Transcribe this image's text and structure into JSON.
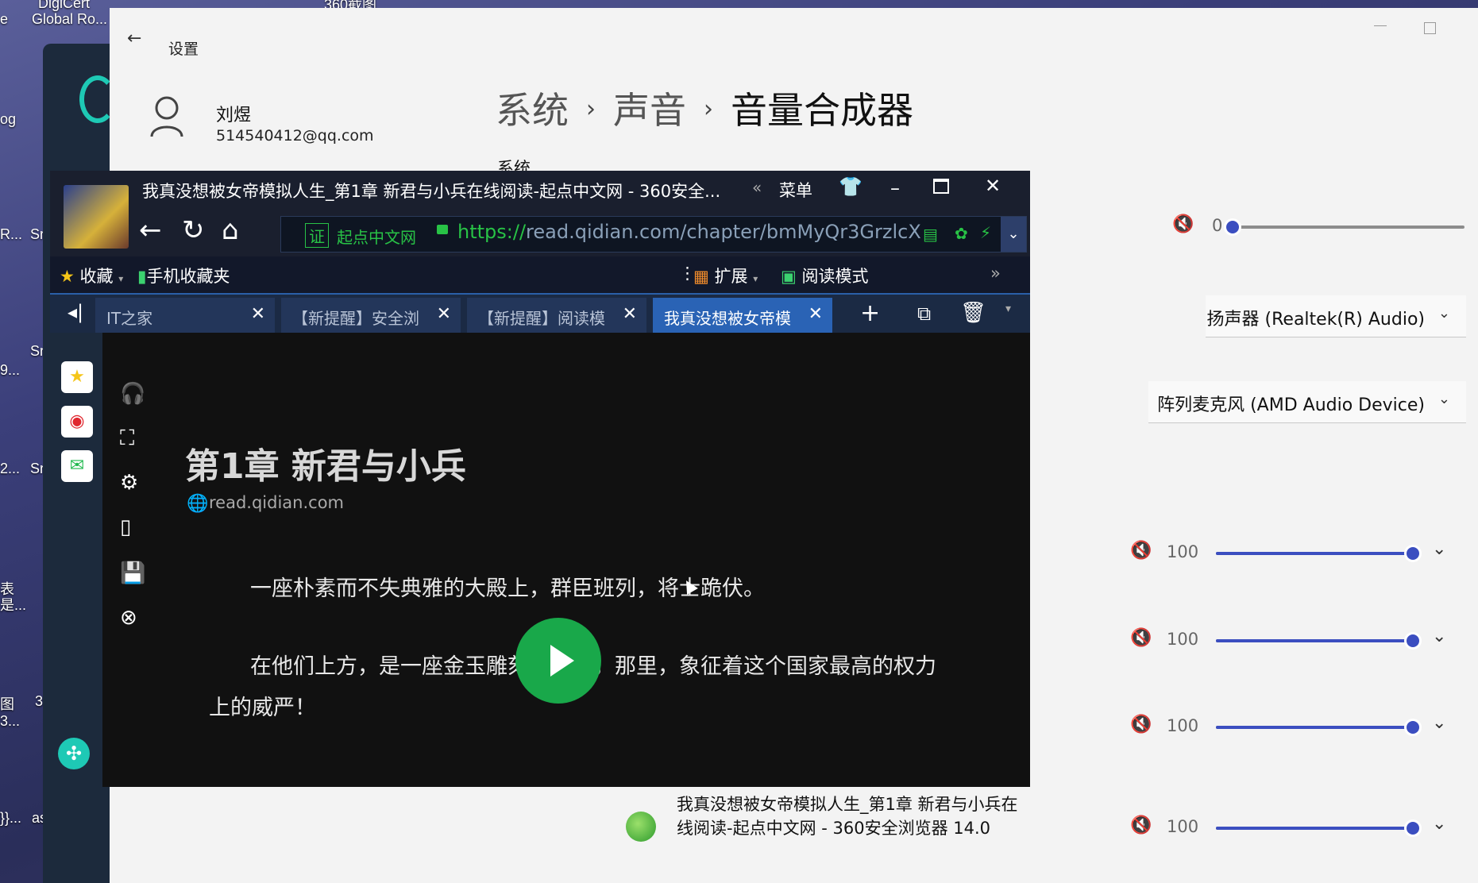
{
  "desktop": {
    "labels": [
      "DigiCert",
      "e",
      "Global Ro...",
      "360截图",
      "og",
      "R...",
      "Sr",
      "Sr",
      "9...",
      "2...",
      "Sr",
      "表",
      "是...",
      "图",
      "3...",
      "3",
      "}}...",
      "as"
    ]
  },
  "settings": {
    "window_title": "设置",
    "user": {
      "name": "刘煜",
      "email": "514540412@qq.com"
    },
    "breadcrumb": [
      "系统",
      "声音",
      "音量合成器"
    ],
    "breadcrumb_sep": "›",
    "section_label": "系统",
    "system_volume": {
      "value": "0",
      "level": 0
    },
    "output_device": "扬声器 (Realtek(R) Audio)",
    "input_device": "阵列麦克风 (AMD Audio Device)",
    "app_rows": [
      {
        "value": "100",
        "level": 100
      },
      {
        "value": "100",
        "level": 100
      },
      {
        "value": "100",
        "level": 100
      },
      {
        "value": "100",
        "level": 100
      }
    ],
    "app_entry": {
      "name": "我真没想被女帝模拟人生_第1章 新君与小兵在线阅读-起点中文网 - 360安全浏览器 14.0"
    }
  },
  "browser": {
    "title": "我真没想被女帝模拟人生_第1章 新君与小兵在线阅读-起点中文网 - 360安全...",
    "menu_label": "菜单",
    "address": {
      "cert_badge": "证",
      "cert_site": "起点中文网",
      "url_scheme": "https://",
      "url_rest": "read.qidian.com/chapter/bmMyQr3GrzlcX"
    },
    "bookmarks": {
      "favorites": "收藏",
      "mobile": "手机收藏夹",
      "extensions": "扩展",
      "reading_mode": "阅读模式"
    },
    "tabs": [
      {
        "label": "IT之家"
      },
      {
        "label": "【新提醒】安全浏"
      },
      {
        "label": "【新提醒】阅读模"
      },
      {
        "label": "我真没想被女帝模"
      }
    ],
    "reader": {
      "chapter_title": "第1章 新君与小兵",
      "site": "read.qidian.com",
      "para1": "一座朴素而不失典雅的大殿上，群臣班列，将士跪伏。",
      "para2_line1": "在他们上方，是一座金玉雕刻的王座，那里，象征着这个国家最高的权力",
      "para2_line2": "上的威严！"
    }
  }
}
